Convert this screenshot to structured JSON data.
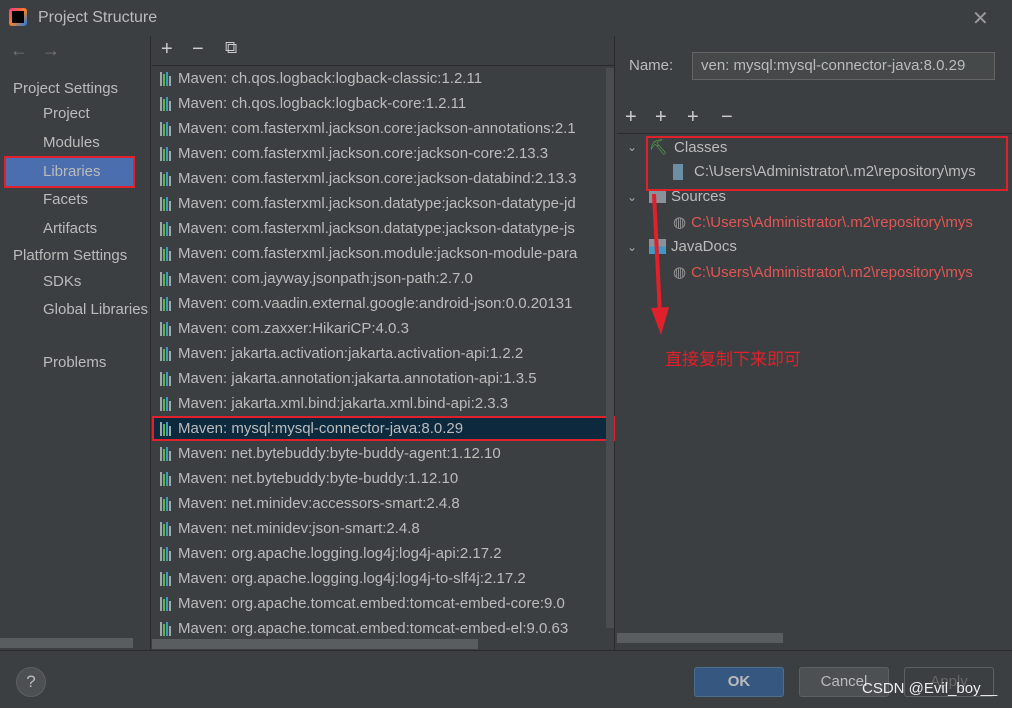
{
  "window": {
    "title": "Project Structure",
    "close": "✕"
  },
  "sidebar": {
    "back": "←",
    "forward": "→",
    "project_settings": "Project Settings",
    "platform_settings": "Platform Settings",
    "items": [
      {
        "label": "Project"
      },
      {
        "label": "Modules"
      },
      {
        "label": "Libraries",
        "selected": true
      },
      {
        "label": "Facets"
      },
      {
        "label": "Artifacts"
      }
    ],
    "platform_items": [
      {
        "label": "SDKs"
      },
      {
        "label": "Global Libraries"
      }
    ],
    "problems": "Problems"
  },
  "list_toolbar": {
    "add": "+",
    "remove": "−",
    "copy": "⧉"
  },
  "libraries": [
    "Maven: ch.qos.logback:logback-classic:1.2.11",
    "Maven: ch.qos.logback:logback-core:1.2.11",
    "Maven: com.fasterxml.jackson.core:jackson-annotations:2.1",
    "Maven: com.fasterxml.jackson.core:jackson-core:2.13.3",
    "Maven: com.fasterxml.jackson.core:jackson-databind:2.13.3",
    "Maven: com.fasterxml.jackson.datatype:jackson-datatype-jd",
    "Maven: com.fasterxml.jackson.datatype:jackson-datatype-js",
    "Maven: com.fasterxml.jackson.module:jackson-module-para",
    "Maven: com.jayway.jsonpath:json-path:2.7.0",
    "Maven: com.vaadin.external.google:android-json:0.0.20131",
    "Maven: com.zaxxer:HikariCP:4.0.3",
    "Maven: jakarta.activation:jakarta.activation-api:1.2.2",
    "Maven: jakarta.annotation:jakarta.annotation-api:1.3.5",
    "Maven: jakarta.xml.bind:jakarta.xml.bind-api:2.3.3",
    "Maven: mysql:mysql-connector-java:8.0.29",
    "Maven: net.bytebuddy:byte-buddy-agent:1.12.10",
    "Maven: net.bytebuddy:byte-buddy:1.12.10",
    "Maven: net.minidev:accessors-smart:2.4.8",
    "Maven: net.minidev:json-smart:2.4.8",
    "Maven: org.apache.logging.log4j:log4j-api:2.17.2",
    "Maven: org.apache.logging.log4j:log4j-to-slf4j:2.17.2",
    "Maven: org.apache.tomcat.embed:tomcat-embed-core:9.0",
    "Maven: org.apache.tomcat.embed:tomcat-embed-el:9.0.63"
  ],
  "selected_index": 14,
  "details": {
    "name_label": "Name:",
    "name_value": "ven: mysql:mysql-connector-java:8.0.29",
    "toolbar": {
      "add": "+",
      "add_url": "+",
      "add_folder": "+",
      "remove": "−"
    },
    "tree": {
      "classes": "Classes",
      "classes_path": "C:\\Users\\Administrator\\.m2\\repository\\mys",
      "sources": "Sources",
      "sources_path": "C:\\Users\\Administrator\\.m2\\repository\\mys",
      "javadocs": "JavaDocs",
      "javadocs_path": "C:\\Users\\Administrator\\.m2\\repository\\mys"
    }
  },
  "annotation": "直接复制下来即可",
  "footer": {
    "help": "?",
    "ok": "OK",
    "cancel": "Cancel",
    "apply": "Apply"
  },
  "watermark": "CSDN @Evil_boy__",
  "colors": {
    "selection": "#0d293e",
    "sidebar_selection": "#4b6eaf",
    "highlight": "#e0202a",
    "ok": "#365880"
  }
}
